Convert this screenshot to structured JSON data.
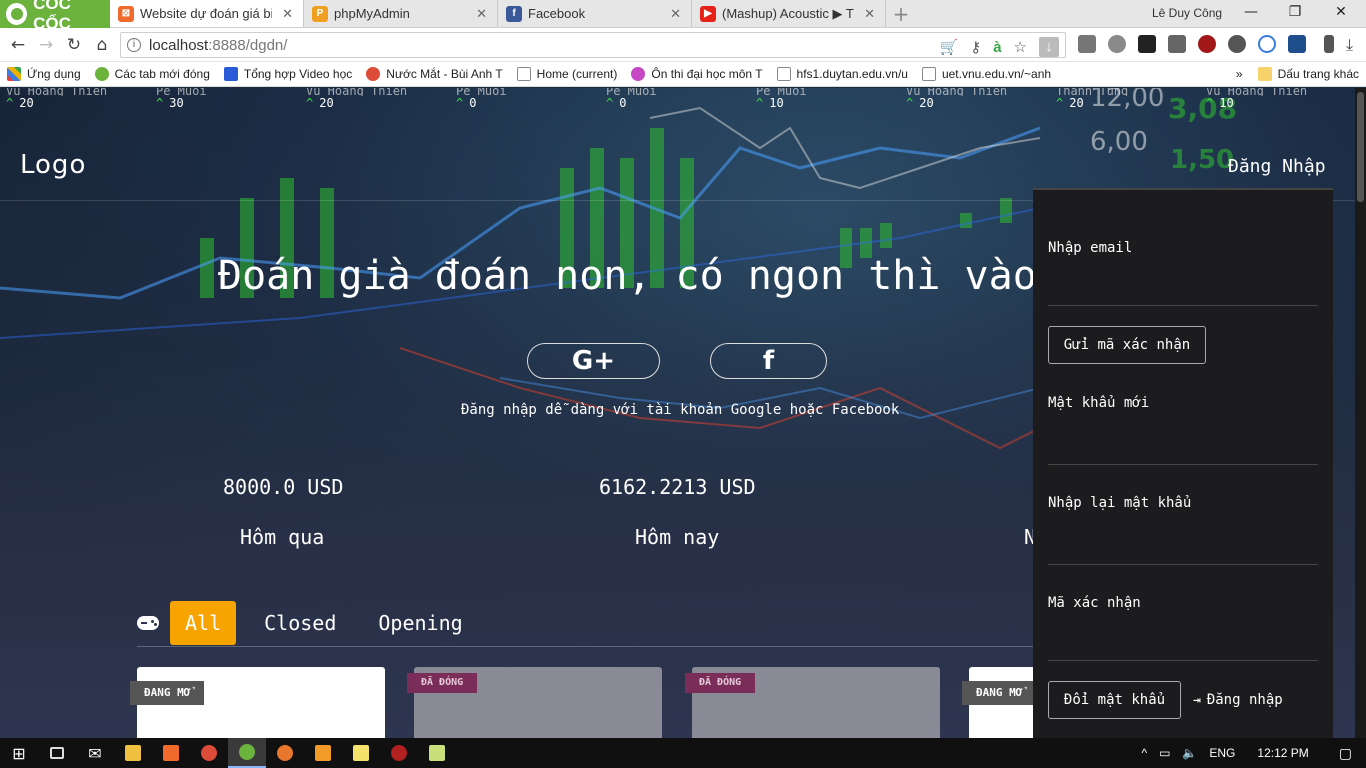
{
  "browser": {
    "tabs": [
      {
        "title": "Website dự đoán giá bitco",
        "icon": "xampp-icon",
        "color": "#f06a2b",
        "active": true
      },
      {
        "title": "phpMyAdmin",
        "icon": "phpmyadmin-icon",
        "color": "#f0a020",
        "active": false
      },
      {
        "title": "Facebook",
        "icon": "facebook-icon",
        "color": "#3b5998",
        "active": false
      },
      {
        "title": "(Mashup) Acoustic ▶ Tình",
        "icon": "youtube-icon",
        "color": "#e62117",
        "active": false
      }
    ],
    "brand": "CỐC CỐC",
    "user": "Lê Duy Công",
    "url_host": "localhost",
    "url_path": ":8888/dgdn/",
    "bookmarks": [
      {
        "label": "Ứng dụng",
        "color": "#e04040"
      },
      {
        "label": "Các tab mới đóng",
        "color": "#6cb33e"
      },
      {
        "label": "Tổng hợp Video học",
        "color": "#2a5bd7"
      },
      {
        "label": "Nước Mắt - Bùi Anh T",
        "color": "#dd4b39"
      },
      {
        "label": "Home (current)",
        "color": "#ffffff"
      },
      {
        "label": "Ôn thi đại học môn T",
        "color": "#c548c5"
      },
      {
        "label": "hfs1.duytan.edu.vn/u",
        "color": "#ffffff"
      },
      {
        "label": "uet.vnu.edu.vn/~anh",
        "color": "#ffffff"
      }
    ],
    "bookmarks_more": "»",
    "bookmarks_folder": "Dấu trang khác"
  },
  "ticker": [
    {
      "name": "Vũ Hoàng Thiện",
      "value": "20"
    },
    {
      "name": "Pé Muội",
      "value": "30"
    },
    {
      "name": "Vũ Hoàng Thiện",
      "value": "20"
    },
    {
      "name": "Pé Muội",
      "value": "0"
    },
    {
      "name": "Pé Muội",
      "value": "0"
    },
    {
      "name": "Pé Muội",
      "value": "10"
    },
    {
      "name": "Vũ Hoàng Thiện",
      "value": "20"
    },
    {
      "name": "Thanh Tùng",
      "value": "20"
    },
    {
      "name": "Vũ Hoàng Thiện",
      "value": "10"
    }
  ],
  "header": {
    "logo": "Logo",
    "login": "Đăng Nhập"
  },
  "hero": {
    "title": "Đoán già đoán non, có ngon thì vào",
    "google_label": "G+",
    "facebook_label": "f",
    "social_note": "Đăng nhập dễ dàng với tài khoản Google hoặc Facebook"
  },
  "prices": {
    "yesterday_value": "8000.0 USD",
    "today_value": "6162.2213 USD",
    "yesterday_label": "Hôm qua",
    "today_label": "Hôm nay",
    "third_label_partial": "N"
  },
  "filters": {
    "tabs": [
      "All",
      "Closed",
      "Opening"
    ],
    "active": "All",
    "accent": "#f7a400"
  },
  "cards": [
    {
      "status": "ĐANG MỞ",
      "card_color": "#ffffff",
      "badge_color": "#555555"
    },
    {
      "status": "ĐÃ ĐÓNG",
      "card_color": "#8a8a96",
      "badge_color": "#7a2d58"
    },
    {
      "status": "ĐÃ ĐÓNG",
      "card_color": "#8a8a96",
      "badge_color": "#7a2d58"
    },
    {
      "status": "ĐANG MỞ",
      "card_color": "#ffffff",
      "badge_color": "#555555"
    }
  ],
  "reset_panel": {
    "email_label": "Nhập email",
    "send_code_button": "Gửi mã xác nhận",
    "new_password_label": "Mật khẩu mới",
    "confirm_password_label": "Nhập lại mật khẩu",
    "code_label": "Mã xác nhận",
    "change_password_button": "Đổi mật khẩu",
    "login_link": "Đăng nhập"
  },
  "taskbar": {
    "lang": "ENG",
    "time": "12:12 PM"
  }
}
